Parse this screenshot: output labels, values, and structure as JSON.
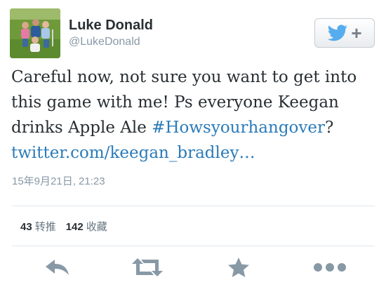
{
  "tweet": {
    "author": {
      "display_name": "Luke Donald",
      "username": "@LukeDonald",
      "avatar_icon": "family-photo-avatar"
    },
    "follow_button": {
      "icon": "twitter-bird-icon",
      "plus": "+"
    },
    "text_parts": [
      "Careful now, not sure you want to get into this game with me! Ps everyone Keegan drinks Apple Ale ",
      "#Howsyourhangover",
      "? ",
      "twitter.com/keegan_bradley…"
    ],
    "timestamp": "15年9月21日, 21:23",
    "stats": {
      "retweets_count": "43",
      "retweets_label": "转推",
      "favorites_count": "142",
      "favorites_label": "收藏"
    },
    "actions": [
      "reply-icon",
      "retweet-icon",
      "favorite-star-icon",
      "more-dots-icon"
    ],
    "colors": {
      "link": "#2b7bb9",
      "twitter_blue": "#55acee",
      "icon_gray": "#8899a6",
      "text": "#292f33"
    }
  }
}
